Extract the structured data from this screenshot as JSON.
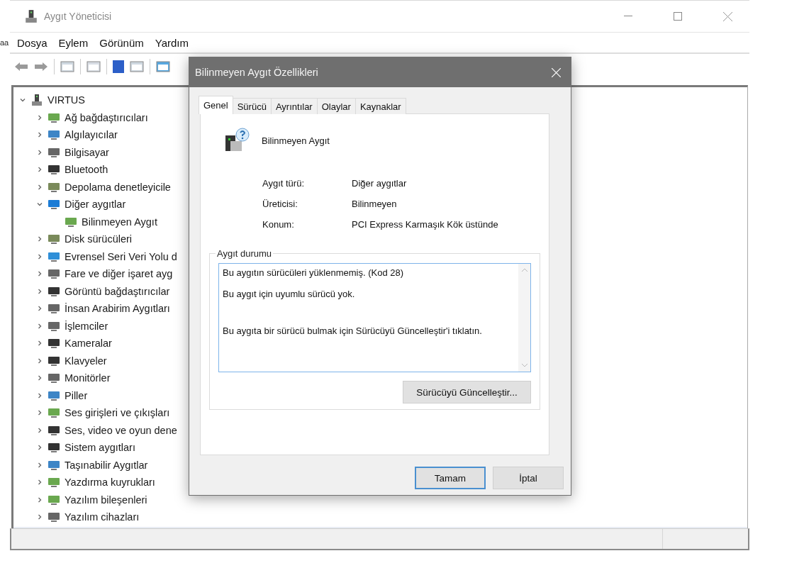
{
  "edge_fragment": "aa",
  "window": {
    "title": "Aygıt Yöneticisi"
  },
  "menu": [
    "Dosya",
    "Eylem",
    "Görünüm",
    "Yardım"
  ],
  "tree": {
    "label": "VIRTUS",
    "expanded": true,
    "children": [
      {
        "label": "Ağ bağdaştırıcıları",
        "expanded": false
      },
      {
        "label": "Algılayıcılar",
        "expanded": false
      },
      {
        "label": "Bilgisayar",
        "expanded": false
      },
      {
        "label": "Bluetooth",
        "expanded": false
      },
      {
        "label": "Depolama denetleyicile",
        "expanded": false
      },
      {
        "label": "Diğer aygıtlar",
        "expanded": true,
        "children": [
          {
            "label": "Bilinmeyen Aygıt"
          }
        ]
      },
      {
        "label": "Disk sürücüleri",
        "expanded": false
      },
      {
        "label": "Evrensel Seri Veri Yolu d",
        "expanded": false
      },
      {
        "label": "Fare ve diğer işaret ayg",
        "expanded": false
      },
      {
        "label": "Görüntü bağdaştırıcılar",
        "expanded": false
      },
      {
        "label": "İnsan Arabirim Aygıtları",
        "expanded": false
      },
      {
        "label": "İşlemciler",
        "expanded": false
      },
      {
        "label": "Kameralar",
        "expanded": false
      },
      {
        "label": "Klavyeler",
        "expanded": false
      },
      {
        "label": "Monitörler",
        "expanded": false
      },
      {
        "label": "Piller",
        "expanded": false
      },
      {
        "label": "Ses girişleri ve çıkışları",
        "expanded": false
      },
      {
        "label": "Ses, video ve oyun dene",
        "expanded": false
      },
      {
        "label": "Sistem aygıtları",
        "expanded": false
      },
      {
        "label": "Taşınabilir Aygıtlar",
        "expanded": false
      },
      {
        "label": "Yazdırma kuyrukları",
        "expanded": false
      },
      {
        "label": "Yazılım bileşenleri",
        "expanded": false
      },
      {
        "label": "Yazılım cihazları",
        "expanded": false
      }
    ]
  },
  "dialog": {
    "title": "Bilinmeyen Aygıt Özellikleri",
    "tabs": [
      {
        "label": "Genel",
        "selected": true
      },
      {
        "label": "Sürücü",
        "selected": false
      },
      {
        "label": "Ayrıntılar",
        "selected": false
      },
      {
        "label": "Olaylar",
        "selected": false
      },
      {
        "label": "Kaynaklar",
        "selected": false
      }
    ],
    "device_name": "Bilinmeyen Aygıt",
    "properties": [
      {
        "label": "Aygıt türü:",
        "value": "Diğer aygıtlar"
      },
      {
        "label": "Üreticisi:",
        "value": "Bilinmeyen"
      },
      {
        "label": "Konum:",
        "value": "PCI Express Karmaşık Kök üstünde"
      }
    ],
    "status_group": {
      "title": "Aygıt durumu",
      "lines": [
        "Bu aygıtın sürücüleri yüklenmemiş. (Kod 28)",
        "Bu aygıt için uyumlu sürücü yok.",
        "Bu aygıta bir sürücü bulmak için Sürücüyü Güncelleştir'i tıklatın."
      ],
      "button": "Sürücüyü Güncelleştir..."
    },
    "buttons": [
      {
        "label": "Tamam",
        "default": true
      },
      {
        "label": "İptal",
        "default": false
      }
    ]
  }
}
